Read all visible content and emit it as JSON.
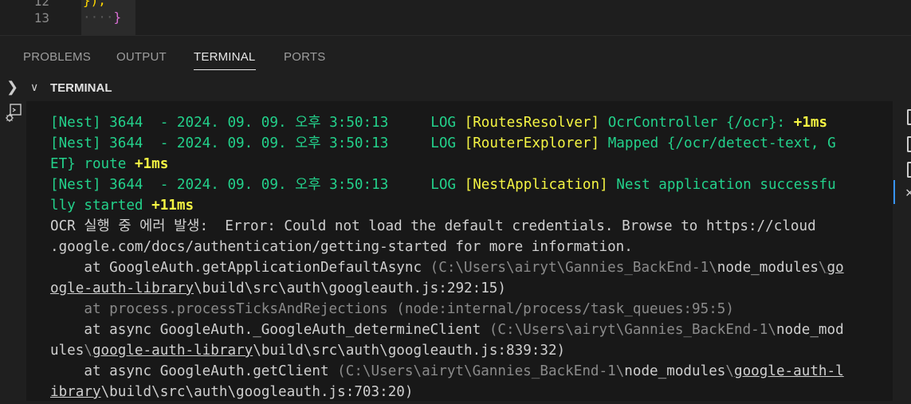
{
  "editor": {
    "line_12": "12",
    "line_13": "13",
    "line_12_code": "});",
    "line_13_dots": "····",
    "line_13_code": "}"
  },
  "panel": {
    "tabs": [
      {
        "label": "PROBLEMS",
        "active": false
      },
      {
        "label": "OUTPUT",
        "active": false
      },
      {
        "label": "TERMINAL",
        "active": true
      },
      {
        "label": "PORTS",
        "active": false
      }
    ],
    "section_title": "TERMINAL"
  },
  "terminal": {
    "lines": [
      {
        "a": "[Nest] 3644  - 2024. 09. 09. 오후 3:50:13     LOG ",
        "b": "[RoutesResolver] ",
        "c": "OcrController {/ocr}: ",
        "d": "+1ms"
      },
      {
        "a": "[Nest] 3644  - 2024. 09. 09. 오후 3:50:13     LOG ",
        "b": "[RouterExplorer] ",
        "c": "Mapped {/ocr/detect-text, G"
      },
      {
        "c": "ET} route ",
        "d": "+1ms"
      },
      {
        "a": "[Nest] 3644  - 2024. 09. 09. 오후 3:50:13     LOG ",
        "b": "[NestApplication] ",
        "c": "Nest application successfu"
      },
      {
        "c": "lly started ",
        "d": "+11ms"
      },
      {
        "text": "OCR 실행 중 에러 발생:  Error: Could not load the default credentials. Browse to https://cloud"
      },
      {
        "text": ".google.com/docs/authentication/getting-started for more information."
      },
      {
        "pre": "    at GoogleAuth.getApplicationDefaultAsync ",
        "dim": "(C:\\Users\\airyt\\Gannies_BackEnd-1\\",
        "mid": "node_modules",
        "dim2": "\\",
        "ul": "go"
      },
      {
        "ul": "ogle-auth-library",
        "dim": "\\build\\src\\auth\\googleauth.js:292:15)"
      },
      {
        "dimall": "    at process.processTicksAndRejections (node:internal/process/task_queues:95:5)"
      },
      {
        "pre": "    at async GoogleAuth._GoogleAuth_determineClient ",
        "dim": "(C:\\Users\\airyt\\Gannies_BackEnd-1\\",
        "mid": "node_mod"
      },
      {
        "mid": "ules",
        "dim2": "\\",
        "ul": "google-auth-library",
        "dim": "\\build\\src\\auth\\googleauth.js:839:32)"
      },
      {
        "pre": "    at async GoogleAuth.getClient ",
        "dim": "(C:\\Users\\airyt\\Gannies_BackEnd-1\\",
        "mid": "node_modules",
        "dim2": "\\",
        "ul": "google-auth-l"
      },
      {
        "ul": "ibrary",
        "dim": "\\build\\src\\auth\\googleauth.js:703:20)"
      }
    ]
  }
}
